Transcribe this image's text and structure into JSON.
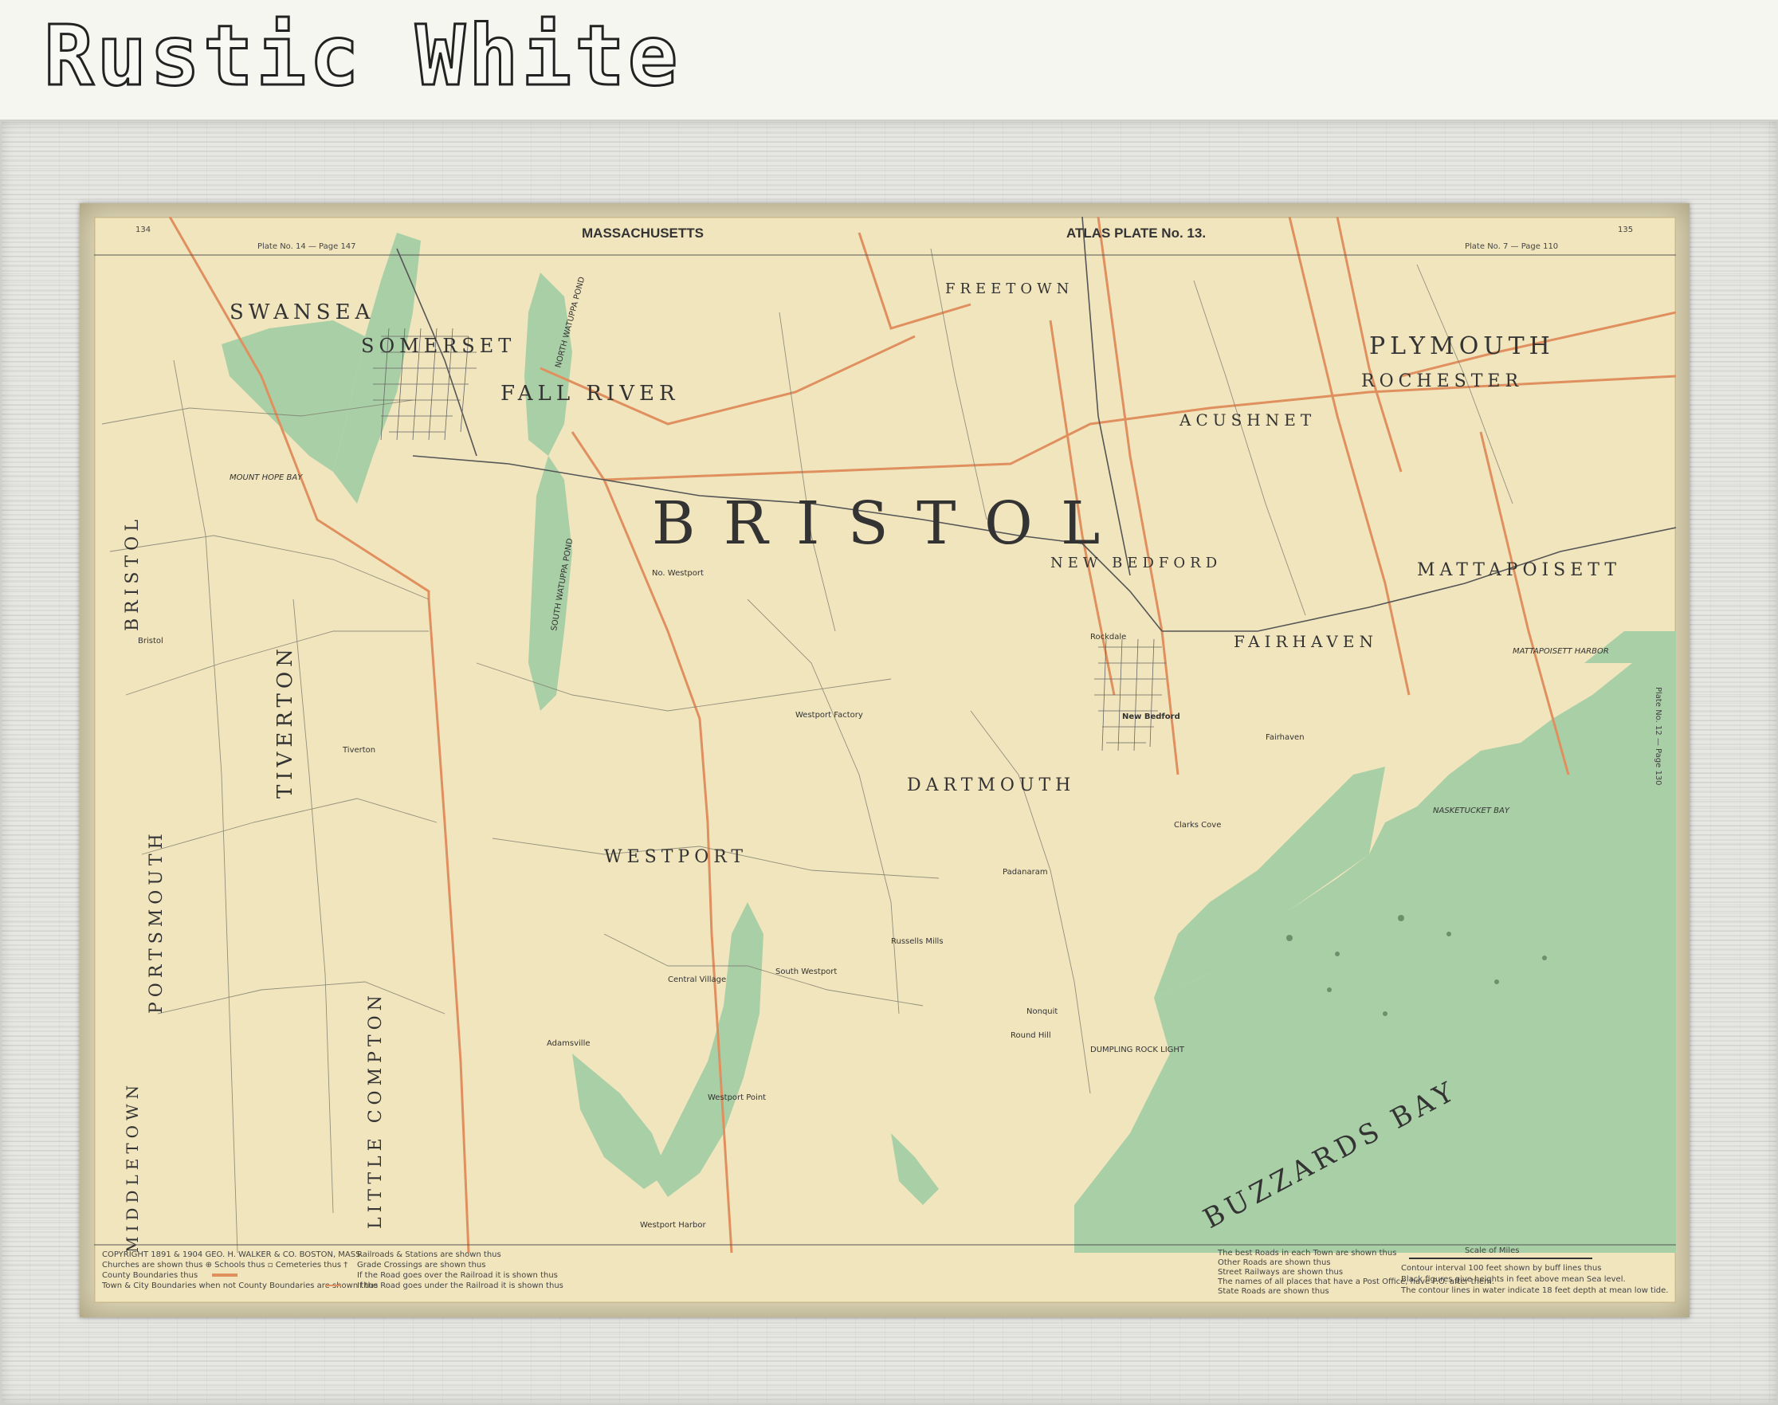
{
  "banner": {
    "title": "Rustic White"
  },
  "map": {
    "page_left": "134",
    "page_right": "135",
    "state_heading": "MASSACHUSETTS",
    "atlas_heading": "ATLAS PLATE No. 13.",
    "plate_left_ref": "Plate No. 14 — Page 147",
    "plate_right_ref": "Plate No. 7 — Page 110",
    "plate_side_ref": "Plate No. 12 — Page 130",
    "county_label": "B R I S T O L",
    "towns": {
      "swansea": "SWANSEA",
      "somerset": "SOMERSET",
      "fall_river": "FALL RIVER",
      "freetown": "FREETOWN",
      "acushnet": "ACUSHNET",
      "new_bedford": "NEW BEDFORD",
      "fairhaven": "FAIRHAVEN",
      "rochester": "ROCHESTER",
      "plymouth": "PLYMOUTH",
      "mattapoisett": "MATTAPOISETT",
      "dartmouth": "DARTMOUTH",
      "westport": "WESTPORT",
      "tiverton": "TIVERTON",
      "little_compton": "LITTLE COMPTON",
      "portsmouth": "PORTSMOUTH",
      "middletown": "MIDDLETOWN",
      "bristol": "BRISTOL",
      "buzzards_bay": "BUZZARDS BAY"
    },
    "places": {
      "mount_hope_bay": "MOUNT HOPE BAY",
      "north_watuppa": "NORTH WATUPPA POND",
      "south_watuppa": "SOUTH WATUPPA POND",
      "westport_factory": "Westport Factory",
      "central_village": "Central Village",
      "south_westport": "South Westport",
      "westport_point": "Westport Point",
      "westport_harbor": "Westport Harbor",
      "padanaram": "Padanaram",
      "russells_mills": "Russells Mills",
      "nasketucket_bay": "NASKETUCKET BAY",
      "mattapoisett_harbor": "MATTAPOISETT HARBOR",
      "nonquit": "Nonquit",
      "dumpling_rock": "DUMPLING ROCK LIGHT",
      "bristol_town": "Bristol",
      "tiverton_town": "Tiverton",
      "adamsville": "Adamsville",
      "no_westport": "No. Westport",
      "rockdale": "Rockdale",
      "new_bedford_po": "New Bedford",
      "fairhaven_po": "Fairhaven",
      "clarks_cove": "Clarks Cove",
      "round_hill": "Round Hill"
    },
    "legend": {
      "copyright": "COPYRIGHT 1891 & 1904 GEO. H. WALKER & CO. BOSTON, MASS.",
      "churches": "Churches are shown thus ⊕ Schools thus ▫ Cemeteries thus †",
      "county_boundaries": "County Boundaries thus",
      "town_boundaries": "Town & City Boundaries when not County Boundaries are shown thus",
      "railroads": "Railroads & Stations are shown thus",
      "grade_crossings": "Grade Crossings are shown thus",
      "road_over": "If the Road goes over the Railroad it is shown thus",
      "road_under": "If the Road goes under the Railroad it is shown thus",
      "best_roads": "The best Roads in each Town are shown thus",
      "other_roads": "Other Roads are shown thus",
      "street_railways": "Street Railways are shown thus",
      "post_offices": "The names of all places that have a Post Office, have P.O. after them.",
      "state_roads": "State Roads are shown thus",
      "scale": "Scale of Miles",
      "contour": "Contour interval 100 feet shown by buff lines thus",
      "black_figures": "Black figures give heights in feet above mean Sea level.",
      "contour_water": "The contour lines in water indicate 18 feet depth at mean low tide."
    },
    "colors": {
      "paper": "#f1e5be",
      "water": "#a9cfa6",
      "boundary": "#e0905e",
      "ink": "#333333"
    }
  }
}
